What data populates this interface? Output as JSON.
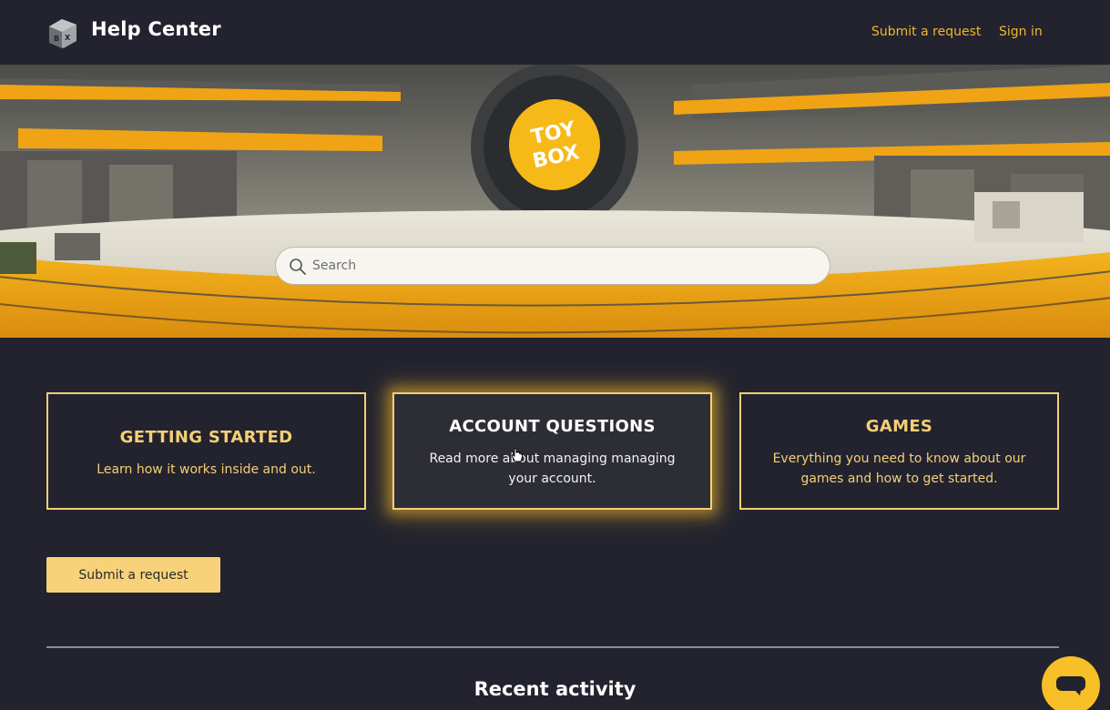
{
  "header": {
    "title": "Help Center",
    "logo_icon": "mytoybox-logo-icon",
    "nav": {
      "submit_request": "Submit a request",
      "sign_in": "Sign in"
    }
  },
  "hero": {
    "search": {
      "placeholder": "Search",
      "value": ""
    }
  },
  "categories": [
    {
      "title": "GETTING STARTED",
      "description": "Learn how it works inside and out."
    },
    {
      "title": "ACCOUNT QUESTIONS",
      "description": "Read more about managing managing your account."
    },
    {
      "title": "GAMES",
      "description": "Everything you need to know about our games and how to get started."
    }
  ],
  "main": {
    "submit_button": "Submit a request",
    "recent_activity_title": "Recent activity"
  },
  "colors": {
    "background": "#22232e",
    "accent": "#f2b62b",
    "card_border": "#f5cf77",
    "button": "#f8d27a"
  }
}
